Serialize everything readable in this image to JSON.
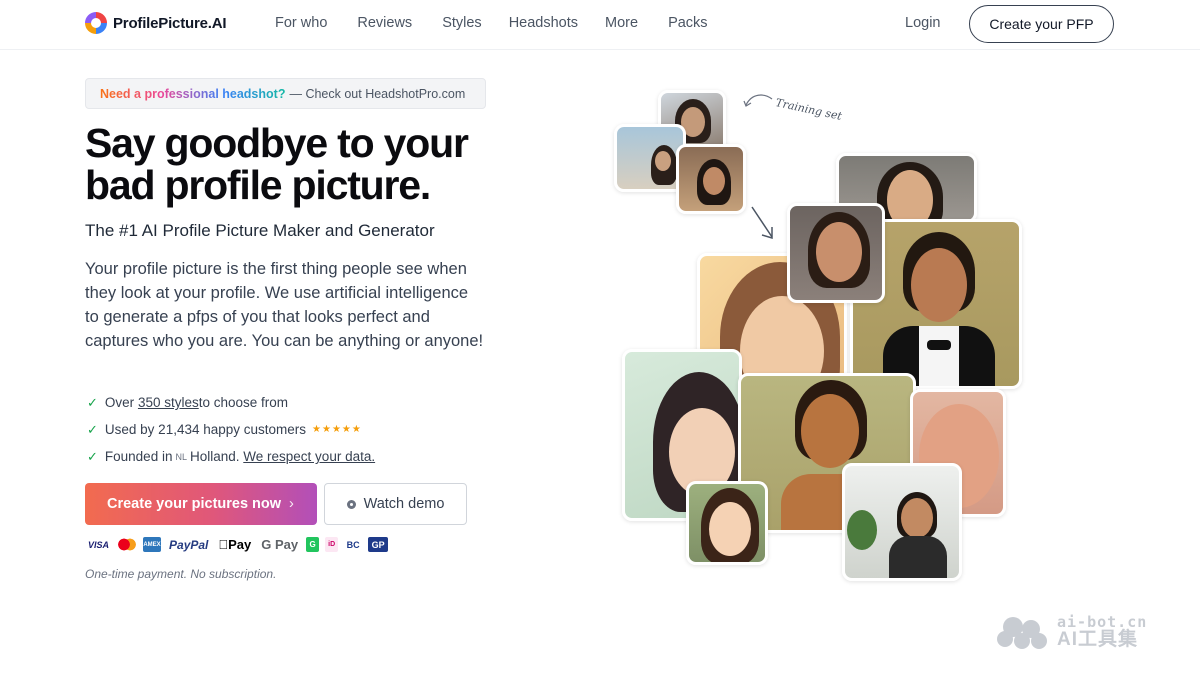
{
  "header": {
    "logo_text": "ProfilePicture.AI",
    "nav": [
      "For who",
      "Reviews",
      "Styles",
      "Headshots",
      "More",
      "Packs"
    ],
    "login": "Login",
    "cta": "Create your PFP"
  },
  "notice": {
    "highlight": "Need a professional headshot?",
    "text": "— Check out HeadshotPro.com"
  },
  "hero": {
    "title": "Say goodbye to your bad profile picture.",
    "subtitle": "The #1 AI Profile Picture Maker and Generator",
    "description": "Your profile picture is the first thing people see when they look at your profile. We use artificial intelligence to generate a pfps of you that looks perfect and captures who you are. You can be anything or anyone!"
  },
  "checks": {
    "item1_prefix": "Over ",
    "item1_link": "350 styles ",
    "item1_suffix": "to choose from",
    "item2": "Used by 21,434 happy customers",
    "item2_stars": "★★★★★",
    "item3_prefix": "Founded in",
    "item3_flag": "NL",
    "item3_country": "Holland.",
    "item3_link": "We respect your data."
  },
  "buttons": {
    "primary": "Create your pictures now",
    "primary_chevron": "›",
    "secondary": "Watch demo"
  },
  "payments": {
    "visa": "VISA",
    "amex": "AMEX",
    "paypal": "PayPal",
    "applepay": "Pay",
    "gpay": "G Pay",
    "giftcard": "G",
    "ideal": "iD",
    "bancontact": "BC",
    "gp": "GP"
  },
  "note": "One-time payment. No subscription.",
  "training_label": "Training set",
  "watermark": {
    "line1": "ai-bot.cn",
    "line2": "AI工具集"
  }
}
